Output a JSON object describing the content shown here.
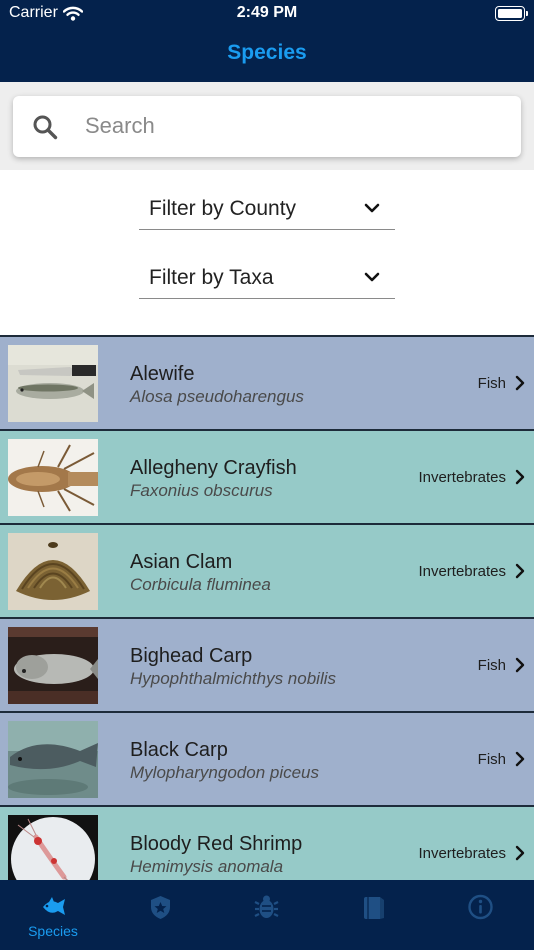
{
  "status_bar": {
    "carrier": "Carrier",
    "time": "2:49 PM"
  },
  "nav": {
    "title": "Species"
  },
  "search": {
    "placeholder": "Search",
    "value": ""
  },
  "filters": {
    "county": {
      "label": "Filter by County"
    },
    "taxa": {
      "label": "Filter by Taxa"
    }
  },
  "species": [
    {
      "common": "Alewife",
      "scientific": "Alosa pseudoharengus",
      "taxa": "Fish",
      "image": "alewife-photo"
    },
    {
      "common": "Allegheny Crayfish",
      "scientific": "Faxonius obscurus",
      "taxa": "Invertebrates",
      "image": "crayfish-photo"
    },
    {
      "common": "Asian Clam",
      "scientific": "Corbicula fluminea",
      "taxa": "Invertebrates",
      "image": "clam-photo"
    },
    {
      "common": "Bighead Carp",
      "scientific": "Hypophthalmichthys nobilis",
      "taxa": "Fish",
      "image": "bighead-carp-photo"
    },
    {
      "common": "Black Carp",
      "scientific": "Mylopharyngodon piceus",
      "taxa": "Fish",
      "image": "black-carp-photo"
    },
    {
      "common": "Bloody Red Shrimp",
      "scientific": "Hemimysis anomala",
      "taxa": "Invertebrates",
      "image": "shrimp-photo"
    }
  ],
  "tabbar": {
    "tabs": [
      {
        "label": "Species",
        "icon": "fish-icon",
        "active": true
      },
      {
        "label": "",
        "icon": "badge-icon",
        "active": false
      },
      {
        "label": "",
        "icon": "bug-icon",
        "active": false
      },
      {
        "label": "",
        "icon": "book-icon",
        "active": false
      },
      {
        "label": "",
        "icon": "info-icon",
        "active": false
      }
    ]
  },
  "colors": {
    "header_bg": "#04224c",
    "accent": "#1a9cf0",
    "row_fish": "#9fb0cc",
    "row_invertebrates": "#96cac8",
    "tab_inactive": "#1f4f84"
  }
}
